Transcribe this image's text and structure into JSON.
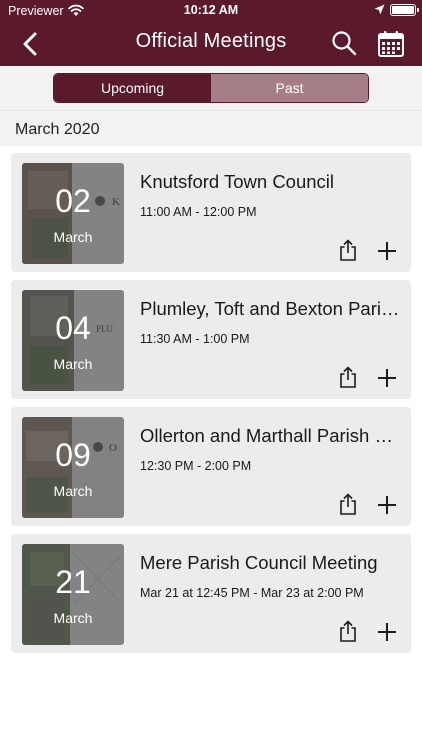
{
  "status_bar": {
    "carrier": "Previewer",
    "time": "10:12 AM"
  },
  "nav": {
    "title": "Official Meetings"
  },
  "segments": {
    "upcoming": "Upcoming",
    "past": "Past"
  },
  "section": {
    "month": "March 2020"
  },
  "meetings": [
    {
      "day": "02",
      "month": "March",
      "name": "Knutsford Town Council",
      "when": "11:00 AM - 12:00 PM"
    },
    {
      "day": "04",
      "month": "March",
      "name": "Plumley, Toft and Bexton Parish Council",
      "when": "11:30 AM - 1:00 PM"
    },
    {
      "day": "09",
      "month": "March",
      "name": "Ollerton and Marthall Parish Council",
      "when": "12:30 PM - 2:00 PM"
    },
    {
      "day": "21",
      "month": "March",
      "name": "Mere Parish Council Meeting",
      "when": "Mar 21 at 12:45 PM - Mar 23 at 2:00 PM"
    }
  ],
  "colors": {
    "brand": "#5b1a2c",
    "segment_inactive": "#a67e87",
    "card": "#ececec"
  },
  "icons": {
    "back": "chevron-left-icon",
    "search": "search-icon",
    "calendar": "calendar-icon",
    "share": "share-icon",
    "add": "plus-icon"
  }
}
